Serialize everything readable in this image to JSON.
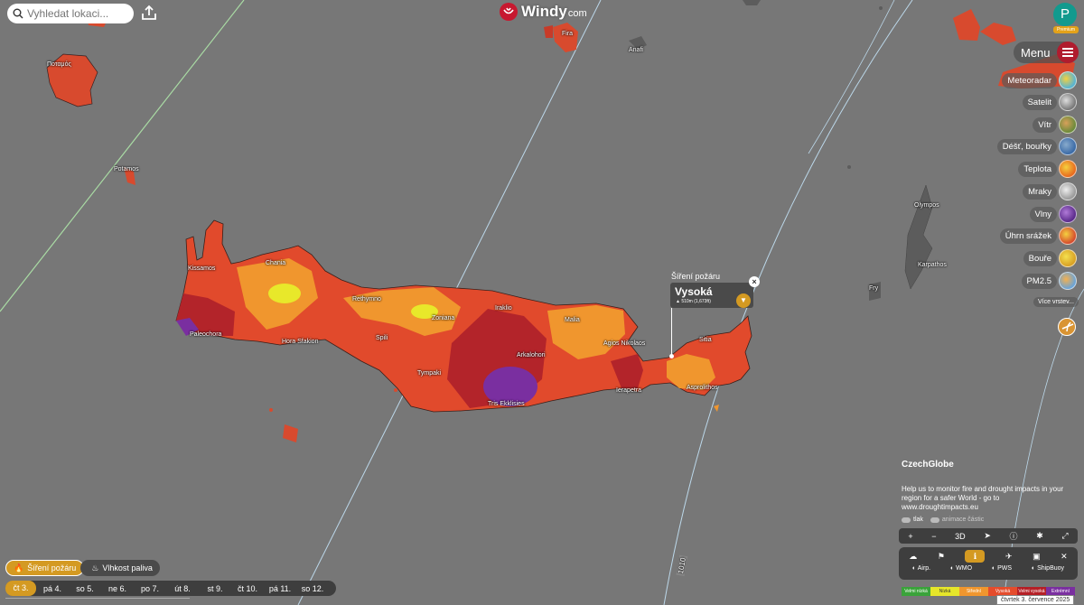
{
  "search": {
    "placeholder": "Vyhledat lokaci..."
  },
  "logo": {
    "name": "Windy",
    "suffix": "com"
  },
  "user": {
    "initial": "P",
    "badge": "Premium"
  },
  "menu": {
    "label": "Menu"
  },
  "layers": [
    {
      "label": "Meteoradar",
      "color": "#55b4d6"
    },
    {
      "label": "Satelit",
      "color": "#888888"
    },
    {
      "label": "Vítr",
      "color": "#b86a3a"
    },
    {
      "label": "Déšť, bouřky",
      "color": "#4a8fc6"
    },
    {
      "label": "Teplota",
      "color": "#e86a1e"
    },
    {
      "label": "Mraky",
      "color": "#9a9a9a"
    },
    {
      "label": "Vlny",
      "color": "#7a3fb0"
    },
    {
      "label": "Úhrn srážek",
      "color": "#d54b2d"
    },
    {
      "label": "Bouře",
      "color": "#e8b224"
    },
    {
      "label": "PM2.5",
      "color": "#6aa4d8"
    }
  ],
  "more_layers": "Více vrstev...",
  "map_labels": {
    "potamos_gr": "Ποταμός",
    "potamos": "Potamos",
    "fira": "Fira",
    "anafi": "Anafi",
    "kissamos": "Kissamos",
    "chania": "Chania",
    "rethymno": "Rethymno",
    "zoniana": "Zoniana",
    "iraklio": "Iraklio",
    "malia": "Malia",
    "agios_nikolaos": "Agios Nikolaos",
    "sitia": "Sitia",
    "paleochora": "Paleochora",
    "hora_sfakion": "Hora Sfakion",
    "spili": "Spili",
    "tympaki": "Tympaki",
    "arkalohori": "Arkalohori",
    "ierapetra": "Ierapetra",
    "tris_ekklisies": "Tris Ekklisies",
    "asprolithos": "Asprolithos",
    "olympos": "Olympos",
    "karpathos": "Karpathos",
    "fry": "Fry",
    "isobar": "1010"
  },
  "popup": {
    "title": "Šíření požáru",
    "value": "Vysoká",
    "elevation": "510m (1,673ft)"
  },
  "czechglobe": {
    "title": "CzechGlobe",
    "text": "Help us to monitor fire and drought impacts in your region for a safer World - go to www.droughtimpacts.eu"
  },
  "toggles": {
    "pressure": "tlak",
    "particles": "animace částic"
  },
  "toolbar": {
    "plus": "+",
    "minus": "−",
    "view3d": "3D"
  },
  "tools2": {
    "airports": "Airp.",
    "wmo": "WMO",
    "pws": "PWS",
    "shipbuoy": "ShipBuoy"
  },
  "legend": [
    {
      "label": "Velmi nízká",
      "color": "#3aa33a"
    },
    {
      "label": "Nízká",
      "color": "#e6e62a"
    },
    {
      "label": "Střední",
      "color": "#f0962e"
    },
    {
      "label": "Vysoká",
      "color": "#e54c2c"
    },
    {
      "label": "Velmi vysoká",
      "color": "#b51f26"
    },
    {
      "label": "Extrémní",
      "color": "#7a2fa0"
    }
  ],
  "date_label": "čtvrtek 3. července 2025",
  "fire_tabs": {
    "active": "Šíření požáru",
    "inactive": "Vlhkost paliva"
  },
  "days": [
    "čt 3.",
    "pá 4.",
    "so 5.",
    "ne 6.",
    "po 7.",
    "út 8.",
    "st 9.",
    "čt 10.",
    "pá 11.",
    "so 12."
  ]
}
